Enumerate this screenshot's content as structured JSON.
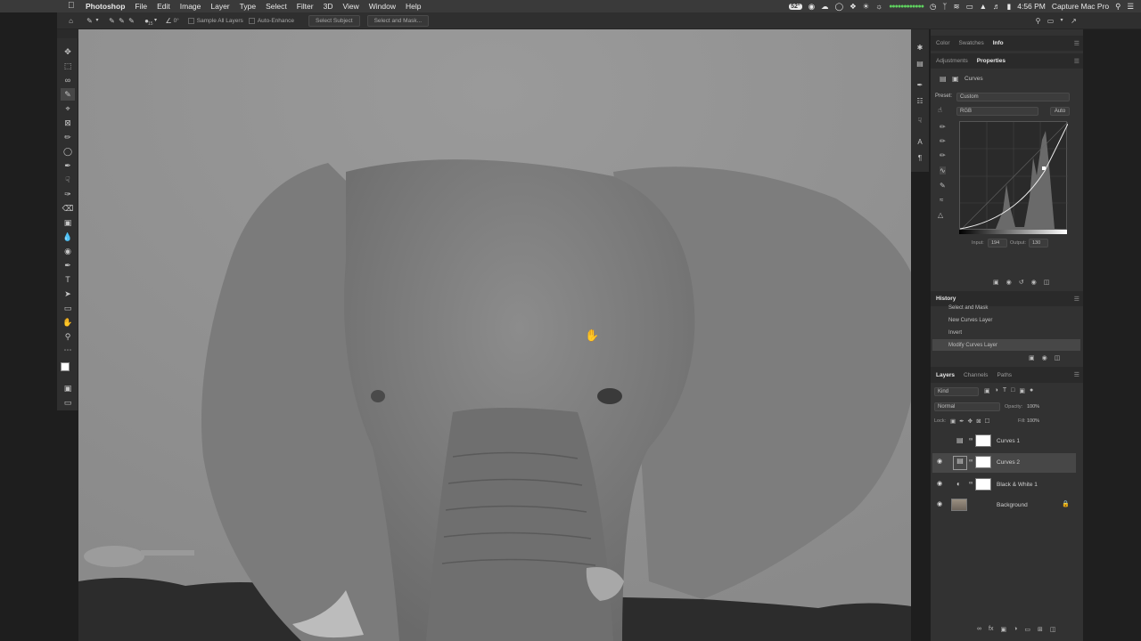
{
  "menubar": {
    "apple": "",
    "app_name": "Photoshop",
    "items": [
      "File",
      "Edit",
      "Image",
      "Layer",
      "Type",
      "Select",
      "Filter",
      "3D",
      "View",
      "Window",
      "Help"
    ],
    "temperature": "52°",
    "time": "4:56 PM",
    "user": "Capture Mac Pro"
  },
  "options": {
    "brush_size": "15",
    "angle": "0°",
    "sample_all_layers": "Sample All Layers",
    "auto_enhance": "Auto-Enhance",
    "select_subject": "Select Subject",
    "select_and_mask": "Select and Mask..."
  },
  "top_panel": {
    "tabs": [
      "Color",
      "Swatches",
      "Info"
    ],
    "active_tab": "Info"
  },
  "properties": {
    "tabs": [
      "Adjustments",
      "Properties"
    ],
    "active_tab": "Properties",
    "layer_type": "Curves",
    "preset_label": "Preset:",
    "preset_value": "Custom",
    "channel": "RGB",
    "auto_label": "Auto",
    "input_label": "Input:",
    "input_value": "194",
    "output_label": "Output:",
    "output_value": "130"
  },
  "history": {
    "title": "History",
    "items": [
      "Select and Mask",
      "New Curves Layer",
      "Invert",
      "Modify Curves Layer"
    ],
    "current_index": 3
  },
  "layers": {
    "tabs": [
      "Layers",
      "Channels",
      "Paths"
    ],
    "active_tab": "Layers",
    "filter": "Kind",
    "blend_mode": "Normal",
    "opacity_label": "Opacity:",
    "opacity_value": "100%",
    "lock_label": "Lock:",
    "fill_label": "Fill:",
    "fill_value": "100%",
    "items": [
      {
        "name": "Curves 1",
        "visible": false
      },
      {
        "name": "Curves 2",
        "visible": true
      },
      {
        "name": "Black & White 1",
        "visible": true
      },
      {
        "name": "Background",
        "visible": true
      }
    ],
    "selected_index": 1
  }
}
